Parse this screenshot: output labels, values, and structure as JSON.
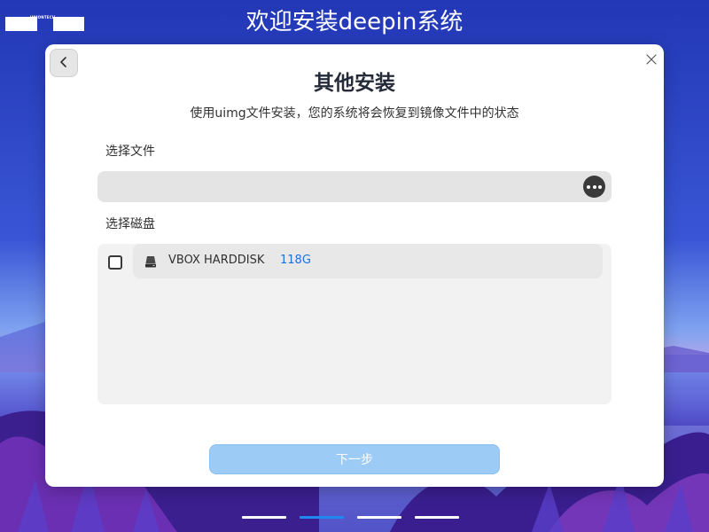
{
  "window": {
    "title": "欢迎安装deepin系统"
  },
  "logo": {
    "text": "UNIONTECH"
  },
  "dialog": {
    "back_icon": "chevron-left-icon",
    "close_icon": "close-icon",
    "title": "其他安装",
    "description": "使用uimg文件安装，您的系统将会恢复到镜像文件中的状态",
    "file_section": {
      "label": "选择文件",
      "value": "",
      "placeholder": "",
      "browse_icon": "more-icon"
    },
    "disk_section": {
      "label": "选择磁盘",
      "disks": [
        {
          "name": "VBOX HARDDISK",
          "size": "118G",
          "checked": false,
          "icon": "disk-drive-icon"
        }
      ]
    },
    "next_button": {
      "label": "下一步",
      "enabled": false
    }
  },
  "steps": {
    "total": 4,
    "current": 2
  },
  "colors": {
    "accent": "#1e88f0",
    "disk_size": "#1a73d9",
    "next_disabled": "#9ccbf6"
  }
}
